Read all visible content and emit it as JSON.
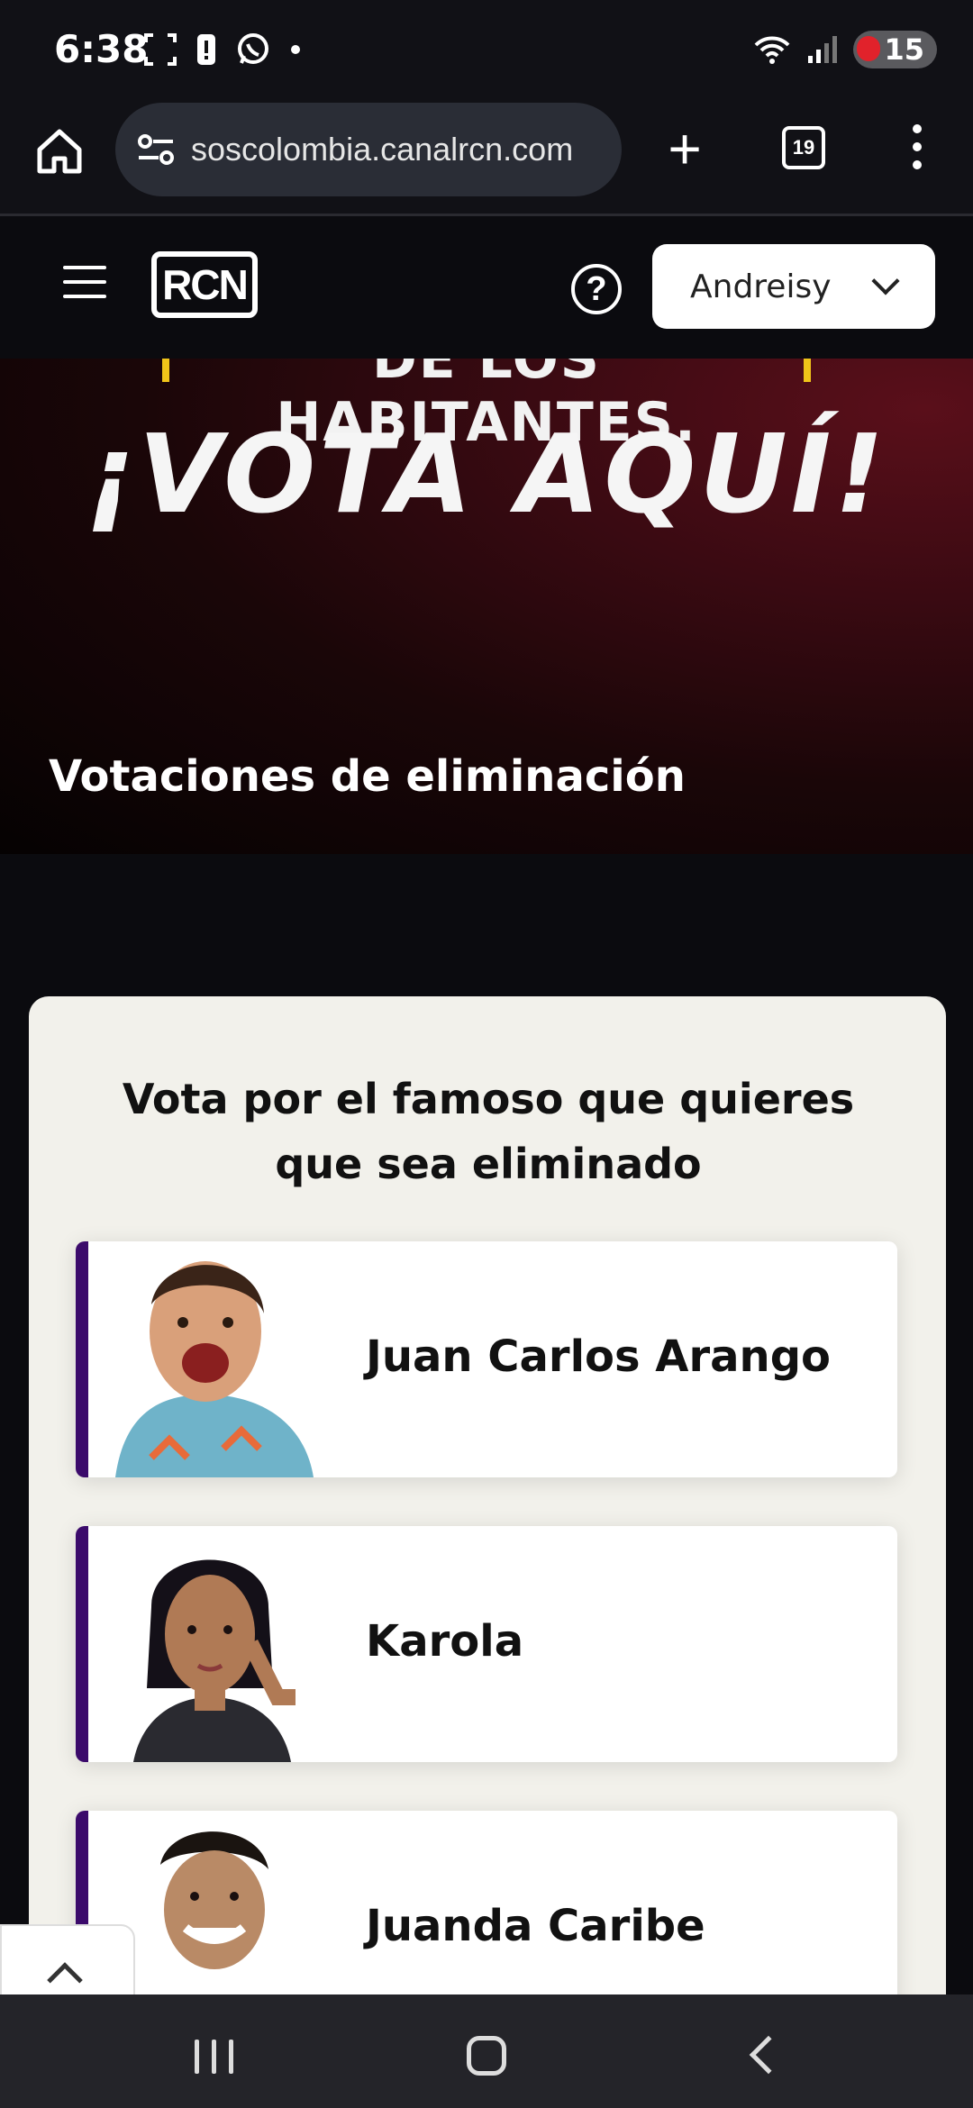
{
  "status_bar": {
    "time": "6:38",
    "battery": "15",
    "left_icons": [
      "screenshot-icon",
      "alert-icon",
      "whatsapp-icon",
      "dot-icon"
    ],
    "right_icons": [
      "wifi-icon",
      "signal-icon"
    ]
  },
  "browser": {
    "url": "soscolombia.canalrcn.com",
    "tab_count": "19"
  },
  "header": {
    "logo_text": "RCN",
    "user_name": "Andreisy"
  },
  "hero": {
    "top_text": "DE LOS HABITANTES.",
    "headline": "¡VOTA AQUÍ!",
    "subtitle": "Votaciones de eliminación"
  },
  "vote": {
    "title": "Vota por el famoso que quieres que sea eliminado",
    "candidates": [
      {
        "name": "Juan Carlos Arango"
      },
      {
        "name": "Karola"
      },
      {
        "name": "Juanda Caribe"
      }
    ]
  },
  "colors": {
    "accent": "#3b0a6b",
    "card_bg": "#f2f1eb",
    "hero_red": "#5a0f1a",
    "highlight_yellow": "#f0c419"
  }
}
